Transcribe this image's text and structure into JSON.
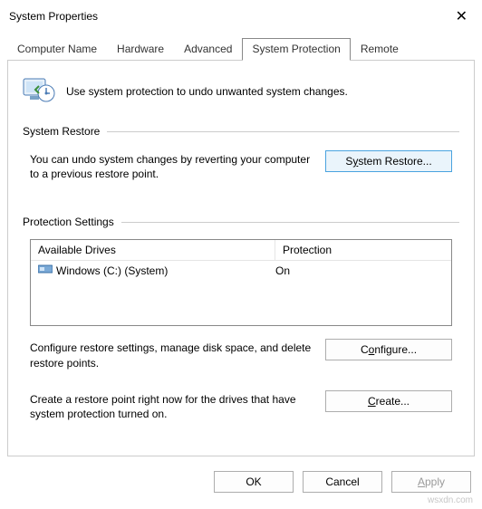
{
  "window": {
    "title": "System Properties"
  },
  "tabs": {
    "computer_name": "Computer Name",
    "hardware": "Hardware",
    "advanced": "Advanced",
    "system_protection": "System Protection",
    "remote": "Remote"
  },
  "intro": "Use system protection to undo unwanted system changes.",
  "restore": {
    "legend": "System Restore",
    "desc": "You can undo system changes by reverting your computer to a previous restore point.",
    "button_pre": "S",
    "button_mn": "y",
    "button_post": "stem Restore..."
  },
  "protection": {
    "legend": "Protection Settings",
    "col_drives": "Available Drives",
    "col_prot": "Protection",
    "row1_name": "Windows (C:) (System)",
    "row1_prot": "On",
    "configure_desc": "Configure restore settings, manage disk space, and delete restore points.",
    "configure_pre": "C",
    "configure_mn": "o",
    "configure_post": "nfigure...",
    "create_desc": "Create a restore point right now for the drives that have system protection turned on.",
    "create_pre": "",
    "create_mn": "C",
    "create_post": "reate..."
  },
  "dialog": {
    "ok": "OK",
    "cancel": "Cancel",
    "apply_pre": "",
    "apply_mn": "A",
    "apply_post": "pply"
  },
  "watermark": "wsxdn.com"
}
